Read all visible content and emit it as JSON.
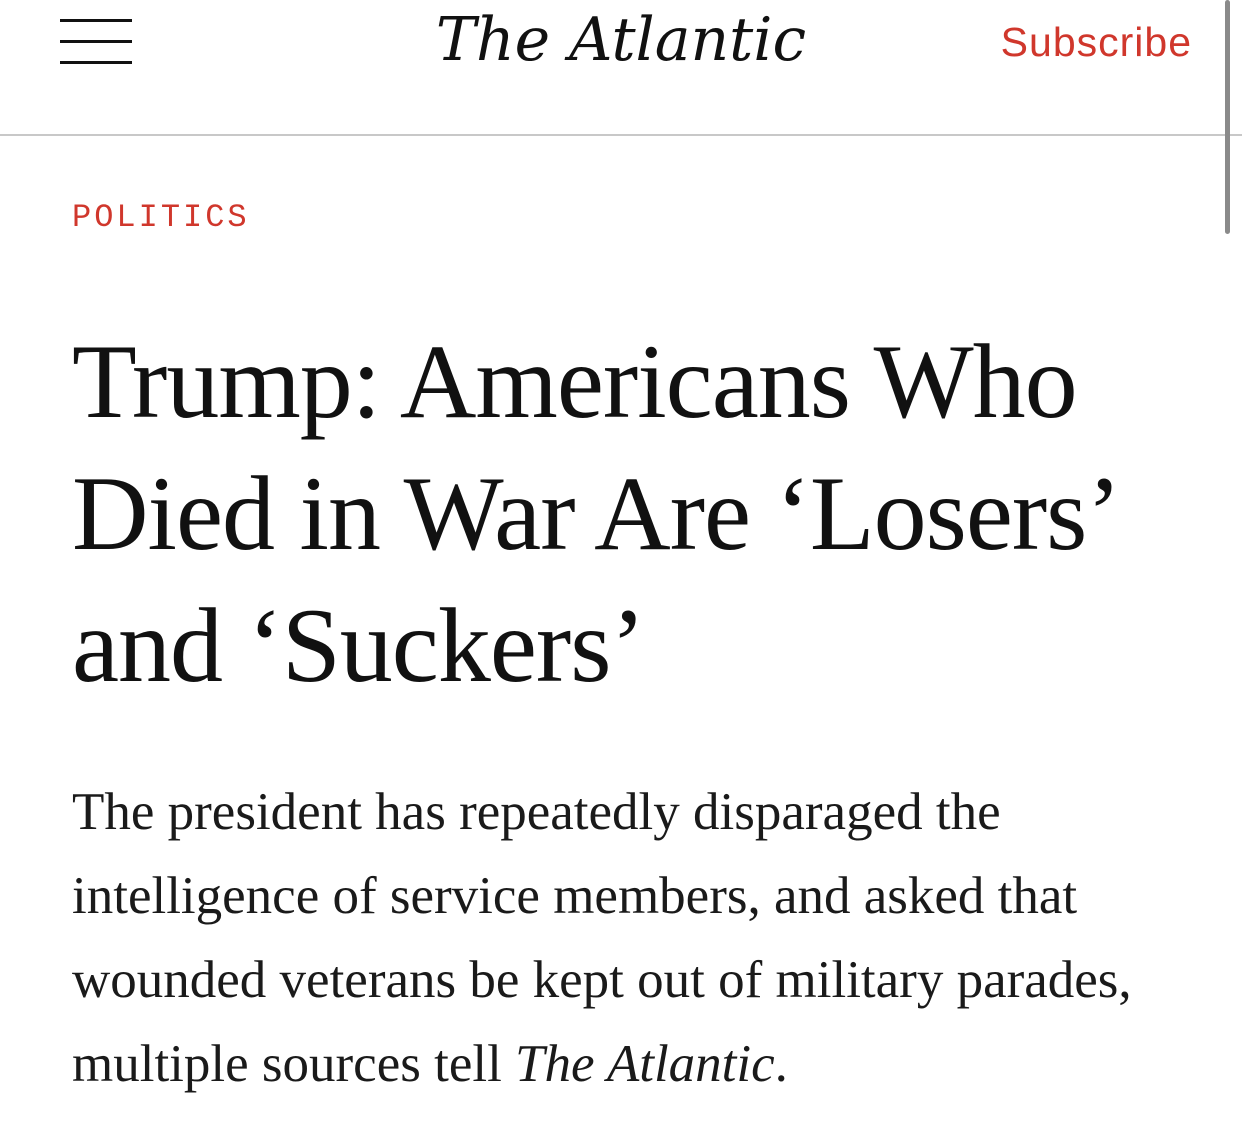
{
  "header": {
    "menu_icon": "hamburger-menu-icon",
    "logo_text": "The Atlantic",
    "subscribe_label": "Subscribe"
  },
  "article": {
    "section": "POLITICS",
    "headline": "Trump: Americans Who Died in War Are ‘Losers’ and ‘Suckers’",
    "dek_prefix": "The president has repeatedly disparaged the intelligence of service members, and asked that wounded veterans be kept out of military parades, multiple sources tell ",
    "dek_publication": "The Atlantic",
    "dek_suffix": "."
  },
  "colors": {
    "accent": "#d0372c",
    "text": "#111111",
    "divider": "#c8c8c8"
  }
}
